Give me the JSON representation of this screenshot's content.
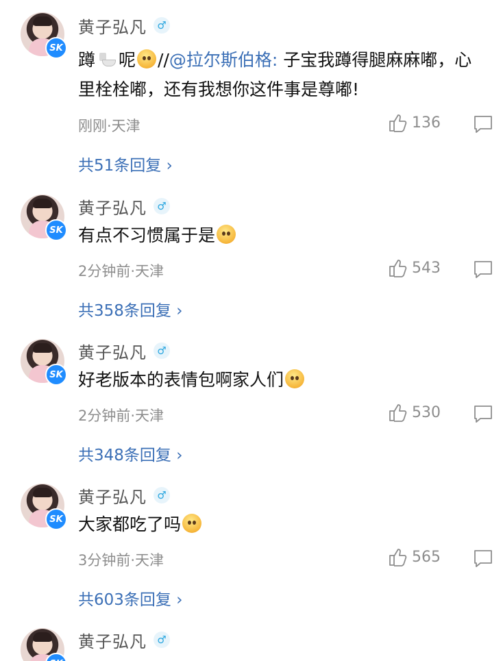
{
  "comments": [
    {
      "username": "黄子弘凡",
      "gender_symbol": "♂",
      "badge": "SK",
      "text_parts": {
        "a": "蹲",
        "b": "呢",
        "c": "//",
        "mention": "@拉尔斯伯格:",
        "d": " 子宝我蹲得腿麻麻嘟，心里栓栓嘟，还有我想你这件事是尊嘟!"
      },
      "time_location": "刚刚·天津",
      "likes": "136",
      "replies_label": "共51条回复 ›"
    },
    {
      "username": "黄子弘凡",
      "gender_symbol": "♂",
      "badge": "SK",
      "text": "有点不习惯属于是",
      "time_location": "2分钟前·天津",
      "likes": "543",
      "replies_label": "共358条回复 ›"
    },
    {
      "username": "黄子弘凡",
      "gender_symbol": "♂",
      "badge": "SK",
      "text": "好老版本的表情包啊家人们",
      "time_location": "2分钟前·天津",
      "likes": "530",
      "replies_label": "共348条回复 ›"
    },
    {
      "username": "黄子弘凡",
      "gender_symbol": "♂",
      "badge": "SK",
      "text": "大家都吃了吗",
      "time_location": "3分钟前·天津",
      "likes": "565",
      "replies_label": "共603条回复 ›"
    },
    {
      "username": "黄子弘凡",
      "gender_symbol": "♂",
      "badge": "SK"
    }
  ],
  "icons": {
    "like": "thumbs-up-icon",
    "reply": "comment-bubble-icon",
    "gender": "male-gender-icon"
  },
  "colors": {
    "link": "#3b6fb6",
    "meta": "#8d8d8d",
    "badge": "#1f8cff"
  }
}
